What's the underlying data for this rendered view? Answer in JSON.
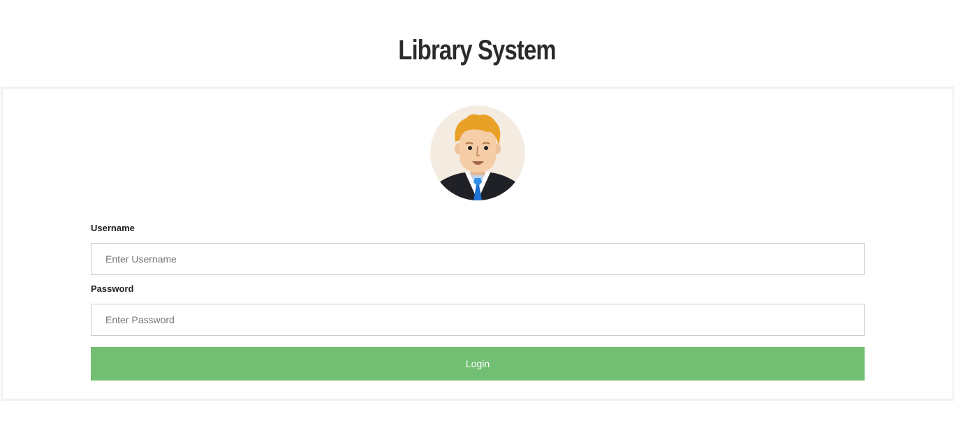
{
  "header": {
    "title": "Library System"
  },
  "form": {
    "avatar_icon": "user-avatar-icon",
    "username_label": "Username",
    "username_placeholder": "Enter Username",
    "password_label": "Password",
    "password_placeholder": "Enter Password",
    "login_label": "Login"
  },
  "colors": {
    "button": "#72bf73",
    "card_border": "#f0f0f0",
    "title": "#2b2b2b"
  }
}
